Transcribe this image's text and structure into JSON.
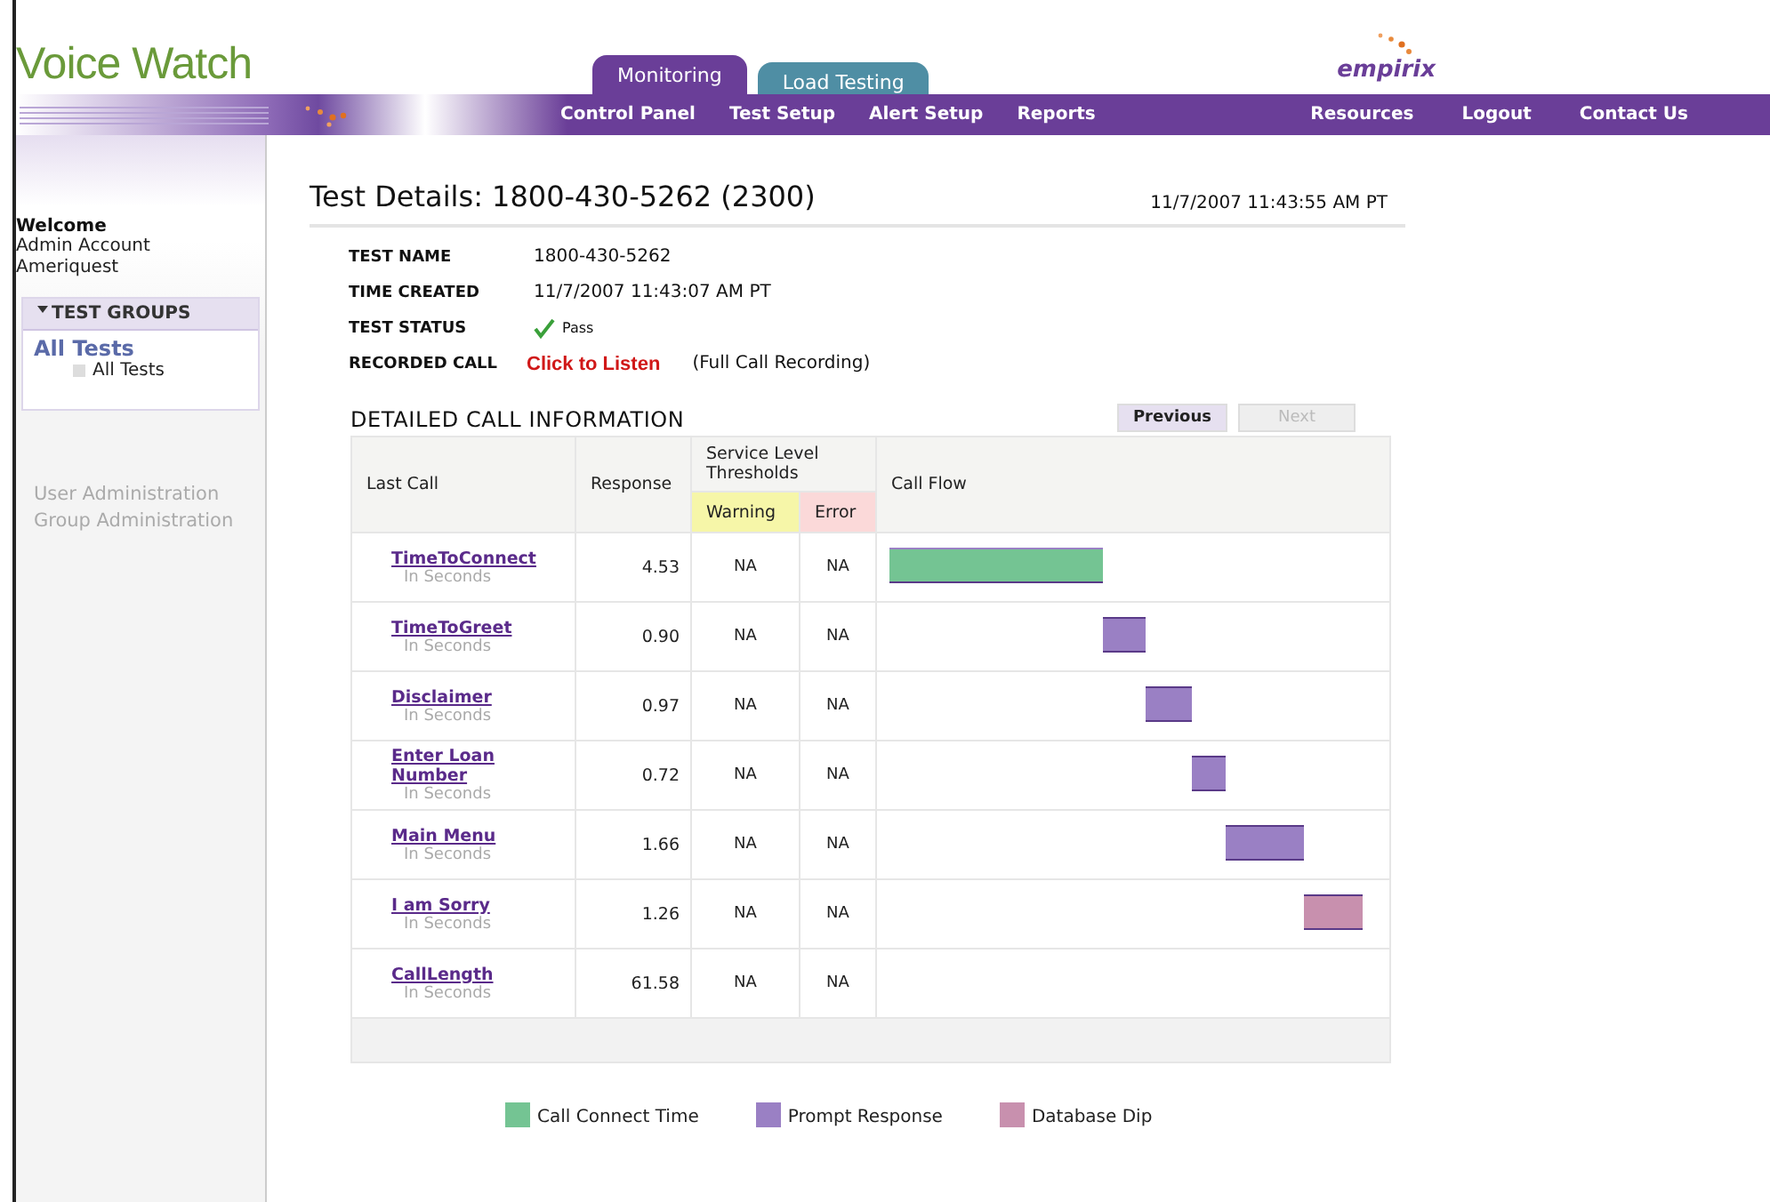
{
  "app": {
    "title": "Voice Watch",
    "logo": "empirix"
  },
  "tabs": [
    {
      "label": "Monitoring",
      "selected": true
    },
    {
      "label": "Load Testing",
      "selected": false
    }
  ],
  "nav_left": [
    "Control Panel",
    "Test Setup",
    "Alert Setup",
    "Reports"
  ],
  "nav_right": [
    "Resources",
    "Logout",
    "Contact Us"
  ],
  "sidebar": {
    "welcome": "Welcome",
    "account": "Admin Account",
    "company": "Ameriquest",
    "groups_header": "TEST GROUPS",
    "groups_expanded": true,
    "group": "All Tests",
    "children": [
      {
        "label": "All Tests"
      }
    ],
    "admin_links": [
      {
        "label": "User Administration",
        "disabled": true
      },
      {
        "label": "Group Administration",
        "disabled": true
      }
    ]
  },
  "details": {
    "title": "Test Details: 1800-430-5262 (2300)",
    "timestamp": "11/7/2007 11:43:55 AM PT",
    "fields": [
      {
        "label": "TEST NAME",
        "value": "1800-430-5262",
        "kind": "text"
      },
      {
        "label": "TIME CREATED",
        "value": "11/7/2007 11:43:07 AM PT",
        "kind": "text"
      },
      {
        "label": "TEST STATUS",
        "value": "Pass",
        "kind": "status",
        "passed": true
      },
      {
        "label": "RECORDED CALL",
        "value": "Click to Listen",
        "note": "(Full Call Recording)",
        "kind": "link"
      }
    ]
  },
  "call_info": {
    "title": "DETAILED CALL INFORMATION",
    "buttons": [
      {
        "label": "Previous",
        "disabled": false
      },
      {
        "label": "Next",
        "disabled": true
      }
    ],
    "columns": [
      "Last Call",
      "Response",
      "Service Level Thresholds",
      "Call Flow"
    ],
    "subcolumns": [
      "Warning",
      "Error"
    ],
    "rows": [
      {
        "name": "TimeToConnect",
        "unit": "In Seconds",
        "response": "4.53",
        "warning": "NA",
        "error": "NA",
        "kind": "connect"
      },
      {
        "name": "TimeToGreet",
        "unit": "In Seconds",
        "response": "0.90",
        "warning": "NA",
        "error": "NA",
        "kind": "prompt"
      },
      {
        "name": "Disclaimer",
        "unit": "In Seconds",
        "response": "0.97",
        "warning": "NA",
        "error": "NA",
        "kind": "prompt"
      },
      {
        "name": "Enter Loan Number",
        "unit": "In Seconds",
        "response": "0.72",
        "warning": "NA",
        "error": "NA",
        "kind": "prompt"
      },
      {
        "name": "Main Menu",
        "unit": "In Seconds",
        "response": "1.66",
        "warning": "NA",
        "error": "NA",
        "kind": "prompt"
      },
      {
        "name": "I am Sorry",
        "unit": "In Seconds",
        "response": "1.26",
        "warning": "NA",
        "error": "NA",
        "kind": "dip"
      },
      {
        "name": "CallLength",
        "unit": "In Seconds",
        "response": "61.58",
        "warning": "NA",
        "error": "NA",
        "kind": "none"
      }
    ],
    "legend": [
      {
        "label": "Call Connect Time",
        "color": "#74c493",
        "kind": "connect"
      },
      {
        "label": "Prompt Response",
        "color": "#9a80c4",
        "kind": "prompt"
      },
      {
        "label": "Database Dip",
        "color": "#c890ae",
        "kind": "dip"
      }
    ]
  }
}
